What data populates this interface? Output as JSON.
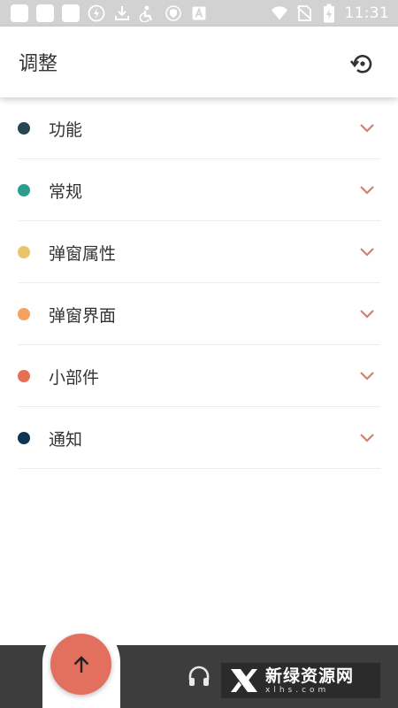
{
  "status_bar": {
    "time": "11:31",
    "icons": [
      "notification-square-icon",
      "notification-square-icon",
      "notification-square-icon",
      "flash-icon",
      "download-icon",
      "accessibility-icon",
      "shield-icon",
      "text-a-icon",
      "wifi-icon",
      "no-sim-icon",
      "battery-charging-icon"
    ]
  },
  "app_bar": {
    "title": "调整",
    "reset_icon": "restore-icon"
  },
  "sections": [
    {
      "label": "功能",
      "dot_color": "#264653"
    },
    {
      "label": "常规",
      "dot_color": "#2a9d8f"
    },
    {
      "label": "弹窗属性",
      "dot_color": "#e9c46a"
    },
    {
      "label": "弹窗界面",
      "dot_color": "#f4a261"
    },
    {
      "label": "小部件",
      "dot_color": "#e76f51"
    },
    {
      "label": "通知",
      "dot_color": "#0f3552"
    }
  ],
  "colors": {
    "chevron": "#d0816f",
    "fab": "#e36f5e",
    "bottom_bar": "#3d3d3d"
  },
  "bottom_bar": {
    "fab_icon": "arrow-up-icon",
    "headphones_icon": "headphones-icon"
  },
  "watermark": {
    "cn": "新绿资源网",
    "en": "xlhs.com"
  }
}
